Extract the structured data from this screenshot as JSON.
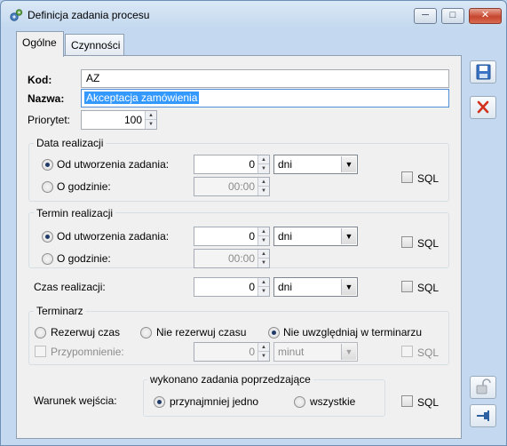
{
  "window": {
    "title": "Definicja zadania procesu",
    "buttons": {
      "minimize": "─",
      "maximize": "□",
      "close": "✕"
    }
  },
  "tabs": [
    {
      "label": "Ogólne"
    },
    {
      "label": "Czynności"
    }
  ],
  "form": {
    "kod_label": "Kod:",
    "kod_value": "AZ",
    "nazwa_label": "Nazwa:",
    "nazwa_value": "Akceptacja zamówienia",
    "priorytet_label": "Priorytet:",
    "priorytet_value": "100"
  },
  "data_realizacji": {
    "title": "Data realizacji",
    "opt1": "Od utworzenia zadania:",
    "opt1_value": "0",
    "opt1_unit": "dni",
    "opt2": "O godzinie:",
    "opt2_value": "00:00",
    "sql": "SQL"
  },
  "termin_realizacji": {
    "title": "Termin realizacji",
    "opt1": "Od utworzenia zadania:",
    "opt1_value": "0",
    "opt1_unit": "dni",
    "opt2": "O godzinie:",
    "opt2_value": "00:00",
    "sql": "SQL"
  },
  "czas_realizacji": {
    "label": "Czas realizacji:",
    "value": "0",
    "unit": "dni",
    "sql": "SQL"
  },
  "terminarz": {
    "title": "Terminarz",
    "opt1": "Rezerwuj czas",
    "opt2": "Nie rezerwuj czasu",
    "opt3": "Nie uwzględniaj w terminarzu",
    "przypomnienie_label": "Przypomnienie:",
    "przypomnienie_value": "0",
    "przypomnienie_unit": "minut",
    "sql": "SQL"
  },
  "warunek": {
    "label": "Warunek wejścia:",
    "group_title": "wykonano zadania poprzedzające",
    "opt1": "przynajmniej jedno",
    "opt2": "wszystkie",
    "sql": "SQL"
  },
  "side_buttons": [
    "save",
    "delete",
    "unlock",
    "pin"
  ]
}
